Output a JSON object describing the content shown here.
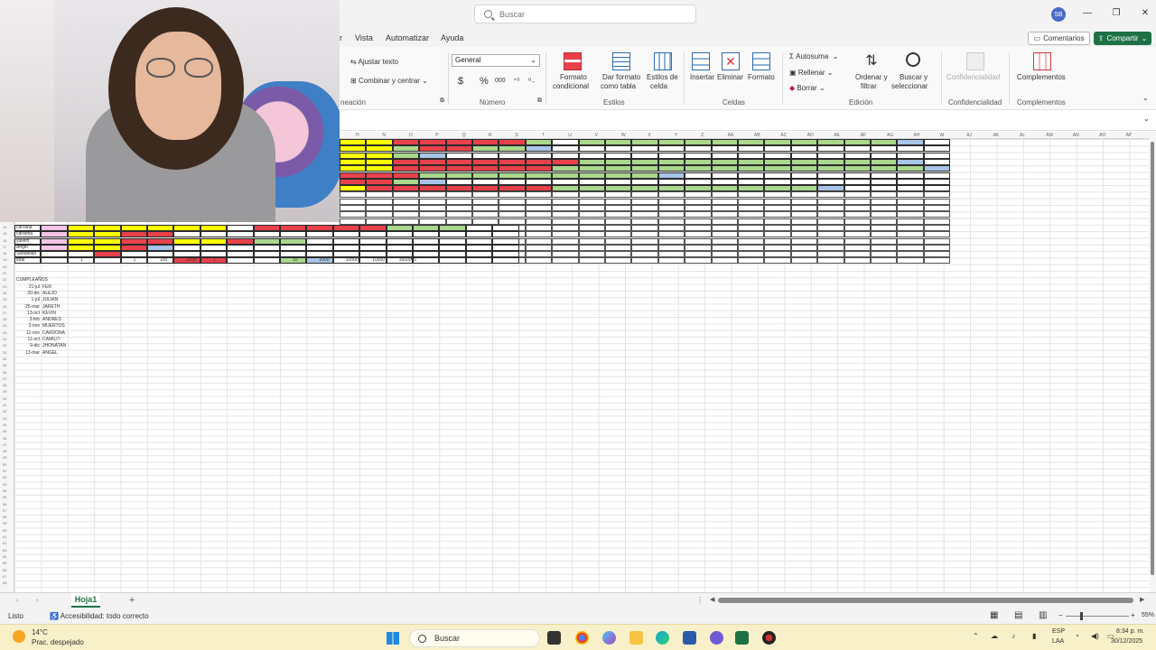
{
  "titlebar": {
    "search_placeholder": "Buscar",
    "avatar_initials": "SB"
  },
  "tabs": [
    "r",
    "Vista",
    "Automatizar",
    "Ayuda"
  ],
  "actions": {
    "comentarios": "Comentarios",
    "compartir": "Compartir"
  },
  "ribbon": {
    "alineacion": {
      "ajustar": "Ajustar texto",
      "combinar": "Combinar y centrar",
      "label": "neación"
    },
    "numero": {
      "format": "General",
      "currency": "$",
      "percent": "%",
      "thousands": "000",
      "label": "Número"
    },
    "estilos": {
      "formato_condicional": [
        "Formato",
        "condicional"
      ],
      "dar_formato": [
        "Dar formato",
        "como tabla"
      ],
      "estilos_celda": [
        "Estilos de",
        "celda"
      ],
      "label": "Estilos"
    },
    "celdas": {
      "insertar": "Insertar",
      "eliminar": "Eliminar",
      "formato": "Formato",
      "label": "Celdas"
    },
    "edicion": {
      "autosuma": "Autosuma",
      "rellenar": "Rellenar",
      "borrar": "Borrar",
      "ordenar": [
        "Ordenar y",
        "filtrar"
      ],
      "buscar": [
        "Buscar y",
        "seleccionar"
      ],
      "label": "Edición"
    },
    "confidencialidad": {
      "btn": "Confidencialidad",
      "label": "Confidencialidad"
    },
    "complementos": {
      "btn": "Complementos",
      "label": "Complementos"
    }
  },
  "sheet": {
    "col_headers": [
      "H",
      "N",
      "O",
      "P",
      "Q",
      "R",
      "S",
      "T",
      "U",
      "V",
      "W",
      "X",
      "Y",
      "Z",
      "AA",
      "AB",
      "AC",
      "AD",
      "AE",
      "AF",
      "AG",
      "AH",
      "AI",
      "AJ",
      "AK",
      "AL",
      "AM",
      "AN",
      "AO",
      "AP"
    ],
    "lower_rows": [
      "carolina",
      "cardona",
      "yulieth",
      "Angel",
      "Sebastian",
      "total"
    ],
    "totals": [
      "1",
      "1",
      "100",
      "2000",
      "1",
      "10",
      "2000",
      "10000",
      "10000",
      "1600000"
    ],
    "cumple_title": "CUMPLEAÑOS",
    "cumples": [
      {
        "date": "21-jul",
        "name": "FER"
      },
      {
        "date": "20-dic",
        "name": "ALEJO"
      },
      {
        "date": "1-jul",
        "name": "JULIAN"
      },
      {
        "date": "25-mar",
        "name": "JARETH"
      },
      {
        "date": "13-oct",
        "name": "KEVIN"
      },
      {
        "date": "3-feb",
        "name": "ANDRES"
      },
      {
        "date": "2-nov",
        "name": "MUERTOS"
      },
      {
        "date": "11-nov",
        "name": "CARDONA"
      },
      {
        "date": "11-oct",
        "name": "CAMILIT"
      },
      {
        "date": "9-dic",
        "name": "JHONATAN"
      },
      {
        "date": "13-mar",
        "name": "ANGEL"
      }
    ]
  },
  "sheet_tab": "Hoja1",
  "status": {
    "ready": "Listo",
    "accessibility": "Accesibilidad: todo correcto",
    "zoom": "55%"
  },
  "taskbar": {
    "weather_temp": "14°C",
    "weather_desc": "Prac. despejado",
    "search": "Buscar",
    "lang": "ESP",
    "lang2": "LAA",
    "time": "8:34 p. m.",
    "date": "30/12/2025"
  },
  "colors": {
    "red": "#e8414b",
    "yellow": "#ffff00",
    "green": "#a9d88d",
    "blue": "#a8c4e8",
    "pink": "#f2c4e6",
    "excel": "#1e7145"
  }
}
